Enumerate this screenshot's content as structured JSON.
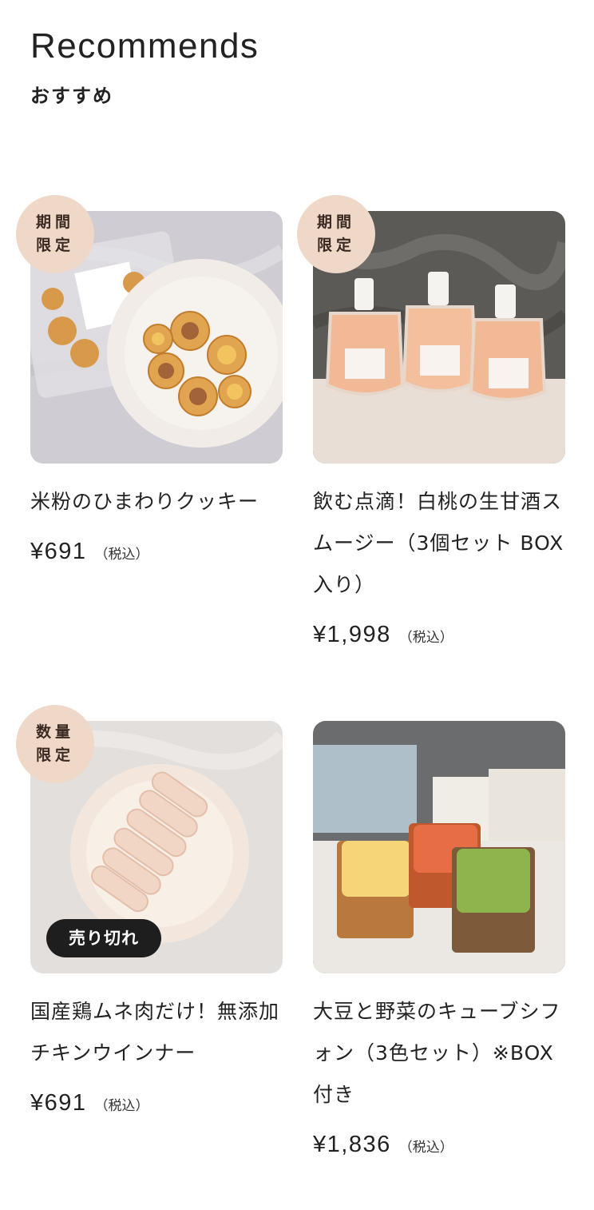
{
  "section": {
    "title_en": "Recommends",
    "title_ja": "おすすめ"
  },
  "products": [
    {
      "name": "米粉のひまわりクッキー",
      "price": "¥691",
      "tax_note": "（税込）",
      "badge_line1": "期間",
      "badge_line2": "限定",
      "image": "sunflower-cookies-image"
    },
    {
      "name": "飲む点滴！白桃の生甘酒スムージー（3個セット BOX入り）",
      "price": "¥1,998",
      "tax_note": "（税込）",
      "badge_line1": "期間",
      "badge_line2": "限定",
      "image": "peach-amazake-smoothie-image"
    },
    {
      "name": "国産鶏ムネ肉だけ！無添加チキンウインナー",
      "price": "¥691",
      "tax_note": "（税込）",
      "badge_line1": "数量",
      "badge_line2": "限定",
      "status": "売り切れ",
      "image": "chicken-sausage-image"
    },
    {
      "name": "大豆と野菜のキューブシフォン（3色セット）※BOX付き",
      "price": "¥1,836",
      "tax_note": "（税込）",
      "image": "cube-chiffon-cake-image"
    }
  ],
  "colors": {
    "badge_bg": "#f0d8c8",
    "sold_out_bg": "#1e1e1e",
    "text": "#222222"
  }
}
